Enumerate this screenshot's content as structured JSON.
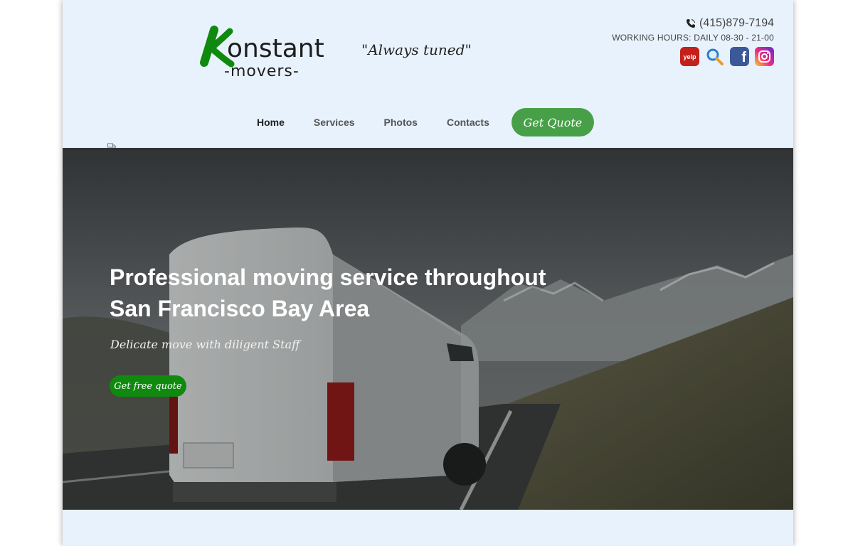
{
  "brand": {
    "logo_word": "onstant",
    "logo_sub": "-movers-",
    "tagline": "\"Always tuned\""
  },
  "contact": {
    "phone": "(415)879-7194",
    "hours": "WORKING HOURS: DAILY 08-30 - 21-00",
    "socials": [
      "yelp-icon",
      "search-icon",
      "facebook-icon",
      "instagram-icon"
    ]
  },
  "nav": {
    "items": [
      "Home",
      "Services",
      "Photos",
      "Contacts"
    ],
    "cta": "Get Quote"
  },
  "hero": {
    "title": "Professional moving service throughout San Francisco Bay Area",
    "subtitle": "Delicate move with diligent Staff",
    "button": "Get free quote"
  },
  "colors": {
    "accent": "#47a047",
    "hero_button": "#0f8a0f",
    "background": "#e8f2fd"
  }
}
